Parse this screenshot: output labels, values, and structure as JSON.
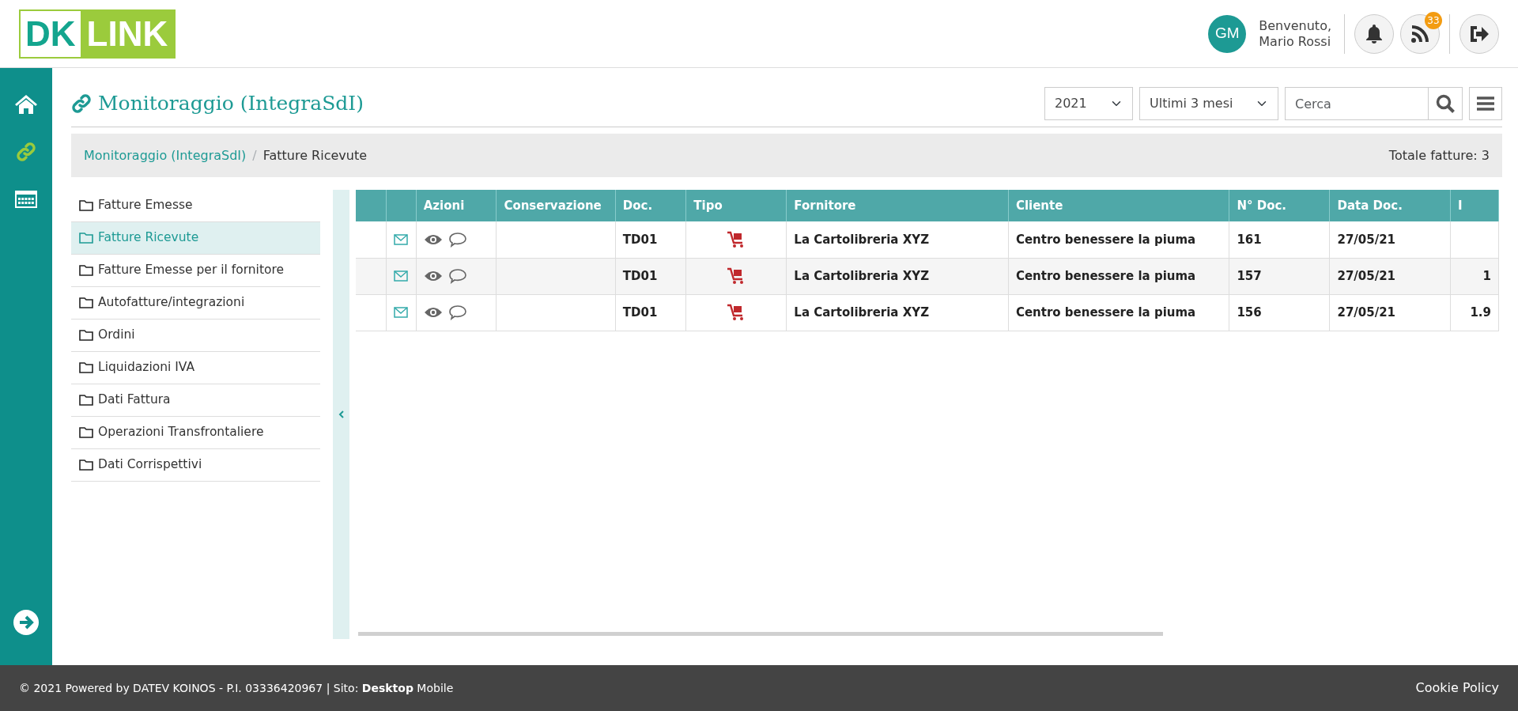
{
  "logo": {
    "part_1": "DK",
    "part_2": "LINK"
  },
  "user": {
    "initials": "GM",
    "greeting": "Benvenuto,",
    "name": "Mario Rossi"
  },
  "header_buttons": [
    {
      "kind": "bell"
    },
    {
      "kind": "rss",
      "badge": "33"
    },
    {
      "kind": "logout"
    }
  ],
  "sidebar": {
    "items": [
      {
        "kind": "home",
        "selected": false
      },
      {
        "kind": "link",
        "selected": true
      },
      {
        "kind": "calendar",
        "selected": false
      },
      {
        "kind": "arrow",
        "selected": false
      }
    ]
  },
  "page": {
    "title": "Monitoraggio (IntegraSdI)"
  },
  "filters": {
    "year": "2021",
    "period": "Ultimi 3 mesi",
    "search_placeholder": "Cerca"
  },
  "breadcrumb_separator": "/",
  "breadcrumb": [
    {
      "label": "Monitoraggio (IntegraSdI)",
      "kind": "link"
    },
    {
      "label": "Fatture Ricevute",
      "kind": "current"
    }
  ],
  "total": "Totale fatture: 3",
  "menu": [
    {
      "label": "Fatture Emesse",
      "selected": false
    },
    {
      "label": "Fatture Ricevute",
      "selected": true
    },
    {
      "label": "Fatture Emesse per il fornitore",
      "selected": false
    },
    {
      "label": "Autofatture/integrazioni",
      "selected": false
    },
    {
      "label": "Ordini",
      "selected": false
    },
    {
      "label": "Liquidazioni IVA",
      "selected": false
    },
    {
      "label": "Dati Fattura",
      "selected": false
    },
    {
      "label": "Operazioni Transfrontaliere",
      "selected": false
    },
    {
      "label": "Dati Corrispettivi",
      "selected": false
    }
  ],
  "table": {
    "columns": [
      "Azioni",
      "Conservazione",
      "Doc.",
      "Tipo",
      "Fornitore",
      "Cliente",
      "N° Doc.",
      "Data Doc.",
      "I"
    ],
    "rows": [
      {
        "doc": "TD01",
        "fornitore": "La Cartolibreria XYZ",
        "cliente": "Centro benessere la piuma",
        "numero": "161",
        "data": "27/05/21"
      },
      {
        "doc": "TD01",
        "fornitore": "La Cartolibreria XYZ",
        "cliente": "Centro benessere la piuma",
        "numero": "157",
        "data": "27/05/21",
        "column_10": "1"
      },
      {
        "doc": "TD01",
        "fornitore": "La Cartolibreria XYZ",
        "cliente": "Centro benessere la piuma",
        "numero": "156",
        "data": "27/05/21",
        "column_10": "1.9"
      }
    ]
  },
  "footer": {
    "text": "© 2021 Powered by DATEV KOINOS - P.I. 03336420967 | Sito: **Desktop** Mobile",
    "cookie": "Cookie Policy"
  }
}
